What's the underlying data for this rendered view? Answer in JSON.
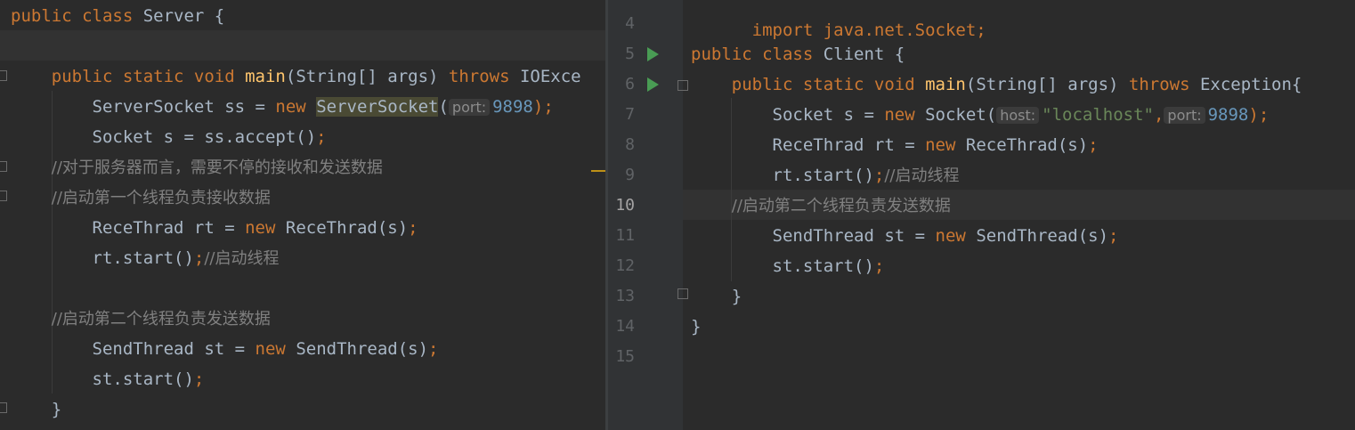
{
  "left": {
    "lines": [
      {
        "parts": [
          {
            "t": "public class ",
            "c": "kw"
          },
          {
            "t": "Server {",
            "c": ""
          }
        ]
      },
      {
        "parts": []
      },
      {
        "parts": [
          {
            "t": "    public static void ",
            "c": "kw"
          },
          {
            "t": "main",
            "c": "fn"
          },
          {
            "t": "(String[] args) ",
            "c": ""
          },
          {
            "t": "throws ",
            "c": "kw"
          },
          {
            "t": "IOExce",
            "c": ""
          }
        ]
      },
      {
        "parts": [
          {
            "t": "        ServerSocket ss = ",
            "c": ""
          },
          {
            "t": "new ",
            "c": "kw"
          },
          {
            "t": "ServerSocket",
            "c": "match-left"
          },
          {
            "t": "(",
            "c": ""
          },
          {
            "t": "port:",
            "c": "hint"
          },
          {
            "t": "9898",
            "c": "num"
          },
          {
            "t": ");",
            "c": "kw"
          }
        ]
      },
      {
        "parts": [
          {
            "t": "        Socket s = ss.accept()",
            "c": ""
          },
          {
            "t": ";",
            "c": "kw"
          }
        ]
      },
      {
        "parts": [
          {
            "t": "        //对于服务器而言，需要不停的接收和发送数据",
            "c": "cm"
          }
        ]
      },
      {
        "parts": [
          {
            "t": "        //启动第一个线程负责接收数据",
            "c": "cm"
          }
        ]
      },
      {
        "parts": [
          {
            "t": "        ReceThrad rt = ",
            "c": ""
          },
          {
            "t": "new ",
            "c": "kw"
          },
          {
            "t": "ReceThrad(s)",
            "c": ""
          },
          {
            "t": ";",
            "c": "kw"
          }
        ]
      },
      {
        "parts": [
          {
            "t": "        rt.start()",
            "c": ""
          },
          {
            "t": ";",
            "c": "kw"
          },
          {
            "t": "//启动线程",
            "c": "cm"
          }
        ]
      },
      {
        "parts": []
      },
      {
        "parts": [
          {
            "t": "        //启动第二个线程负责发送数据",
            "c": "cm"
          }
        ]
      },
      {
        "parts": [
          {
            "t": "        SendThread st = ",
            "c": ""
          },
          {
            "t": "new ",
            "c": "kw"
          },
          {
            "t": "SendThread(s)",
            "c": ""
          },
          {
            "t": ";",
            "c": "kw"
          }
        ]
      },
      {
        "parts": [
          {
            "t": "        st.start()",
            "c": ""
          },
          {
            "t": ";",
            "c": "kw"
          }
        ]
      },
      {
        "parts": [
          {
            "t": "    }",
            "c": ""
          }
        ]
      }
    ]
  },
  "right": {
    "line_numbers": [
      "4",
      "5",
      "6",
      "7",
      "8",
      "9",
      "10",
      "11",
      "12",
      "13",
      "14",
      "15"
    ],
    "current_line": "10",
    "top_partial": "import java.net.Socket;",
    "lines": [
      {
        "parts": []
      },
      {
        "parts": [
          {
            "t": "public class ",
            "c": "kw"
          },
          {
            "t": "Client {",
            "c": ""
          }
        ]
      },
      {
        "parts": [
          {
            "t": "    public static void ",
            "c": "kw"
          },
          {
            "t": "main",
            "c": "fn"
          },
          {
            "t": "(String[] args) ",
            "c": ""
          },
          {
            "t": "throws ",
            "c": "kw"
          },
          {
            "t": "Exception{",
            "c": ""
          }
        ]
      },
      {
        "parts": [
          {
            "t": "        Socket s = ",
            "c": ""
          },
          {
            "t": "new ",
            "c": "kw"
          },
          {
            "t": "Socket(",
            "c": ""
          },
          {
            "t": "host:",
            "c": "hint"
          },
          {
            "t": "\"localhost\"",
            "c": "str"
          },
          {
            "t": ",",
            "c": "kw"
          },
          {
            "t": "port:",
            "c": "hint"
          },
          {
            "t": "9898",
            "c": "num"
          },
          {
            "t": ");",
            "c": "kw"
          }
        ]
      },
      {
        "parts": [
          {
            "t": "        ReceThrad rt = ",
            "c": ""
          },
          {
            "t": "new ",
            "c": "kw"
          },
          {
            "t": "ReceThrad(s)",
            "c": ""
          },
          {
            "t": ";",
            "c": "kw"
          }
        ]
      },
      {
        "parts": [
          {
            "t": "        rt.start()",
            "c": ""
          },
          {
            "t": ";",
            "c": "kw"
          },
          {
            "t": "//启动线程",
            "c": "cm"
          }
        ]
      },
      {
        "parts": [
          {
            "t": "        //启动第二个线程负责发送数据",
            "c": "cm"
          }
        ]
      },
      {
        "parts": [
          {
            "t": "        SendThread st = ",
            "c": ""
          },
          {
            "t": "new ",
            "c": "kw"
          },
          {
            "t": "SendThread(s)",
            "c": ""
          },
          {
            "t": ";",
            "c": "kw"
          }
        ]
      },
      {
        "parts": [
          {
            "t": "        st.start()",
            "c": ""
          },
          {
            "t": ";",
            "c": "kw"
          }
        ]
      },
      {
        "parts": [
          {
            "t": "    }",
            "c": ""
          }
        ]
      },
      {
        "parts": [
          {
            "t": "}",
            "c": ""
          }
        ]
      },
      {
        "parts": []
      }
    ]
  },
  "colors": {
    "background": "#2b2b2b",
    "gutter": "#313335",
    "keyword": "#cc7832",
    "function": "#ffc66d",
    "string": "#6a8759",
    "number": "#6897bb",
    "comment": "#808080",
    "run_icon": "#499c54"
  },
  "icons": [
    "run-icon",
    "fold-icon"
  ]
}
